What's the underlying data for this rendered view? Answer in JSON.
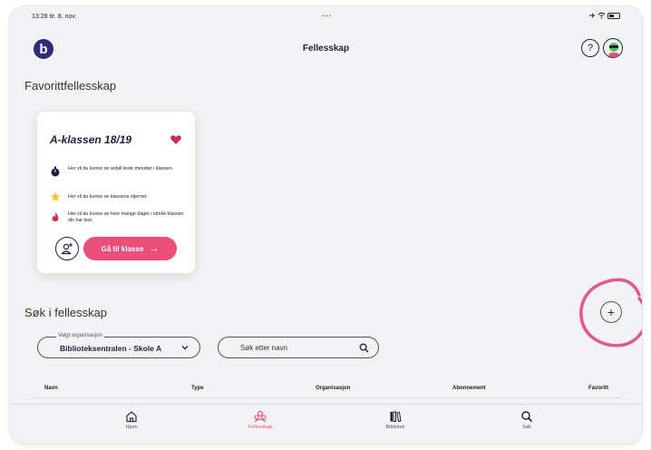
{
  "status": {
    "time": "13:28  tir. 8. nov.",
    "dots": "•••"
  },
  "header": {
    "logo_letter": "b",
    "title": "Fellesskap",
    "help": "?"
  },
  "favorites": {
    "heading": "Favorittfellesskap",
    "card": {
      "title": "A-klassen 18/19",
      "rows": [
        {
          "icon": "stopwatch-icon",
          "text": "Her vil du kunne se antall leste minutter i klassen."
        },
        {
          "icon": "star-icon",
          "text": "Her vil du kunne se klassens stjerner."
        },
        {
          "icon": "flame-icon",
          "text": "Her vil du kunne se hvor mange dager i strekk klassen din har lest."
        }
      ],
      "go_label": "Gå til klasse",
      "go_arrow": "→"
    }
  },
  "search": {
    "heading": "Søk i fellesskap",
    "plus": "+",
    "org_legend": "Valgt organisasjon",
    "org_value": "Biblioteksentralen - Skole A",
    "name_placeholder": "Søk etter navn"
  },
  "table": {
    "columns": [
      "Navn",
      "Type",
      "Organisasjon",
      "Abonnement",
      "Favoritt"
    ]
  },
  "tabs": [
    {
      "label": "Hjem",
      "icon": "home-icon",
      "active": false
    },
    {
      "label": "Fellesskap",
      "icon": "community-icon",
      "active": true
    },
    {
      "label": "Bibliotek",
      "icon": "library-icon",
      "active": false
    },
    {
      "label": "Søk",
      "icon": "search-icon",
      "active": false
    }
  ],
  "colors": {
    "accent": "#ea4f79",
    "navy": "#1f1f3a",
    "background": "#f3f3f5"
  }
}
